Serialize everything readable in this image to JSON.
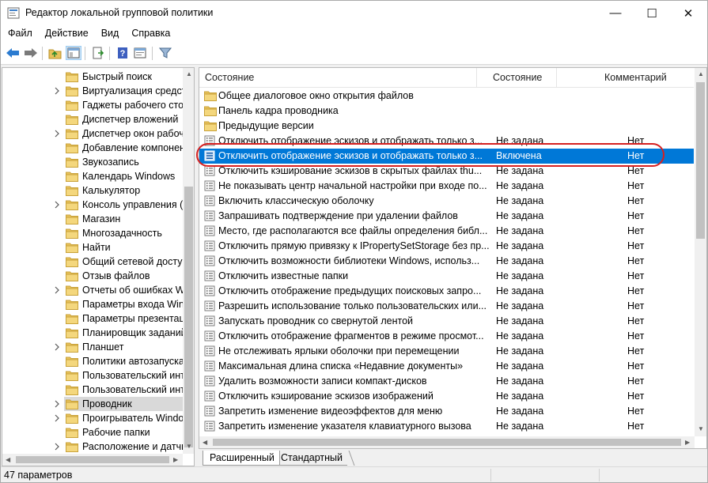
{
  "window": {
    "title": "Редактор локальной групповой политики",
    "min_symbol": "—",
    "max_symbol": "☐",
    "close_symbol": "✕"
  },
  "menu": [
    "Файл",
    "Действие",
    "Вид",
    "Справка"
  ],
  "toolbar": {
    "buttons": [
      "back-icon",
      "forward-icon",
      "up-folder-icon",
      "show-hide-tree-icon",
      "export-list-icon",
      "help-icon",
      "properties-icon",
      "filter-icon"
    ]
  },
  "tree": {
    "items": [
      {
        "label": "Быстрый поиск",
        "expandable": false
      },
      {
        "label": "Виртуализация средств",
        "expandable": true
      },
      {
        "label": "Гаджеты рабочего стола",
        "expandable": false
      },
      {
        "label": "Диспетчер вложений",
        "expandable": false
      },
      {
        "label": "Диспетчер окон рабочего стола",
        "expandable": true
      },
      {
        "label": "Добавление компонентов",
        "expandable": false
      },
      {
        "label": "Звукозапись",
        "expandable": false
      },
      {
        "label": "Календарь Windows",
        "expandable": false
      },
      {
        "label": "Калькулятор",
        "expandable": false
      },
      {
        "label": "Консоль управления (MMC)",
        "expandable": true
      },
      {
        "label": "Магазин",
        "expandable": false
      },
      {
        "label": "Многозадачность",
        "expandable": false
      },
      {
        "label": "Найти",
        "expandable": false
      },
      {
        "label": "Общий сетевой доступ",
        "expandable": false
      },
      {
        "label": "Отзыв файлов",
        "expandable": false
      },
      {
        "label": "Отчеты об ошибках Windows",
        "expandable": true
      },
      {
        "label": "Параметры входа Windows",
        "expandable": false
      },
      {
        "label": "Параметры презентации",
        "expandable": false
      },
      {
        "label": "Планировщик заданий",
        "expandable": false
      },
      {
        "label": "Планшет",
        "expandable": true
      },
      {
        "label": "Политики автозапуска",
        "expandable": false
      },
      {
        "label": "Пользовательский интерфейс",
        "expandable": false
      },
      {
        "label": "Пользовательский интерфейс",
        "expandable": false
      },
      {
        "label": "Проводник",
        "expandable": true,
        "selected": true
      },
      {
        "label": "Проигрыватель Windows Media",
        "expandable": true
      },
      {
        "label": "Рабочие папки",
        "expandable": false
      },
      {
        "label": "Расположение и датчики",
        "expandable": true
      }
    ]
  },
  "list": {
    "columns": {
      "name": "Состояние",
      "state": "Состояние",
      "comment": "Комментарий"
    },
    "rows": [
      {
        "icon": "folder",
        "name": "Общее диалоговое окно открытия файлов",
        "state": "",
        "comment": ""
      },
      {
        "icon": "folder",
        "name": "Панель кадра проводника",
        "state": "",
        "comment": ""
      },
      {
        "icon": "folder",
        "name": "Предыдущие версии",
        "state": "",
        "comment": ""
      },
      {
        "icon": "setting",
        "name": "Отключить отображение эскизов и отображать только з...",
        "state": "Не задана",
        "comment": "Нет"
      },
      {
        "icon": "setting",
        "name": "Отключить отображение эскизов и отображать только з...",
        "state": "Включена",
        "comment": "Нет",
        "highlighted": true
      },
      {
        "icon": "setting",
        "name": "Отключить кэширование эскизов в скрытых файлах thu...",
        "state": "Не задана",
        "comment": "Нет"
      },
      {
        "icon": "setting",
        "name": "Не показывать центр начальной настройки при входе по...",
        "state": "Не задана",
        "comment": "Нет"
      },
      {
        "icon": "setting",
        "name": "Включить классическую оболочку",
        "state": "Не задана",
        "comment": "Нет"
      },
      {
        "icon": "setting",
        "name": "Запрашивать подтверждение при удалении файлов",
        "state": "Не задана",
        "comment": "Нет"
      },
      {
        "icon": "setting",
        "name": "Место, где располагаются все файлы определения библ...",
        "state": "Не задана",
        "comment": "Нет"
      },
      {
        "icon": "setting",
        "name": "Отключить прямую привязку к IPropertySetStorage без пр...",
        "state": "Не задана",
        "comment": "Нет"
      },
      {
        "icon": "setting",
        "name": "Отключить возможности библиотеки Windows, использ...",
        "state": "Не задана",
        "comment": "Нет"
      },
      {
        "icon": "setting",
        "name": "Отключить известные папки",
        "state": "Не задана",
        "comment": "Нет"
      },
      {
        "icon": "setting",
        "name": "Отключить отображение предыдущих поисковых запро...",
        "state": "Не задана",
        "comment": "Нет"
      },
      {
        "icon": "setting",
        "name": "Разрешить использование только пользовательских или...",
        "state": "Не задана",
        "comment": "Нет"
      },
      {
        "icon": "setting",
        "name": "Запускать проводник со свернутой лентой",
        "state": "Не задана",
        "comment": "Нет"
      },
      {
        "icon": "setting",
        "name": "Отключить отображение фрагментов в режиме просмот...",
        "state": "Не задана",
        "comment": "Нет"
      },
      {
        "icon": "setting",
        "name": "Не отслеживать ярлыки оболочки при перемещении",
        "state": "Не задана",
        "comment": "Нет"
      },
      {
        "icon": "setting",
        "name": "Максимальная длина списка «Недавние документы»",
        "state": "Не задана",
        "comment": "Нет"
      },
      {
        "icon": "setting",
        "name": "Удалить возможности записи компакт-дисков",
        "state": "Не задана",
        "comment": "Нет"
      },
      {
        "icon": "setting",
        "name": "Отключить кэширование эскизов изображений",
        "state": "Не задана",
        "comment": "Нет"
      },
      {
        "icon": "setting",
        "name": "Запретить изменение видеоэффектов для меню",
        "state": "Не задана",
        "comment": "Нет"
      },
      {
        "icon": "setting",
        "name": "Запретить изменение указателя клавиатурного вызова",
        "state": "Не задана",
        "comment": "Нет"
      }
    ]
  },
  "tabs": {
    "extended": "Расширенный",
    "standard": "Стандартный"
  },
  "status": {
    "text": "47 параметров"
  },
  "colors": {
    "highlight": "#0078d7",
    "annotation": "#d62020",
    "folder": "#e8c15a"
  }
}
